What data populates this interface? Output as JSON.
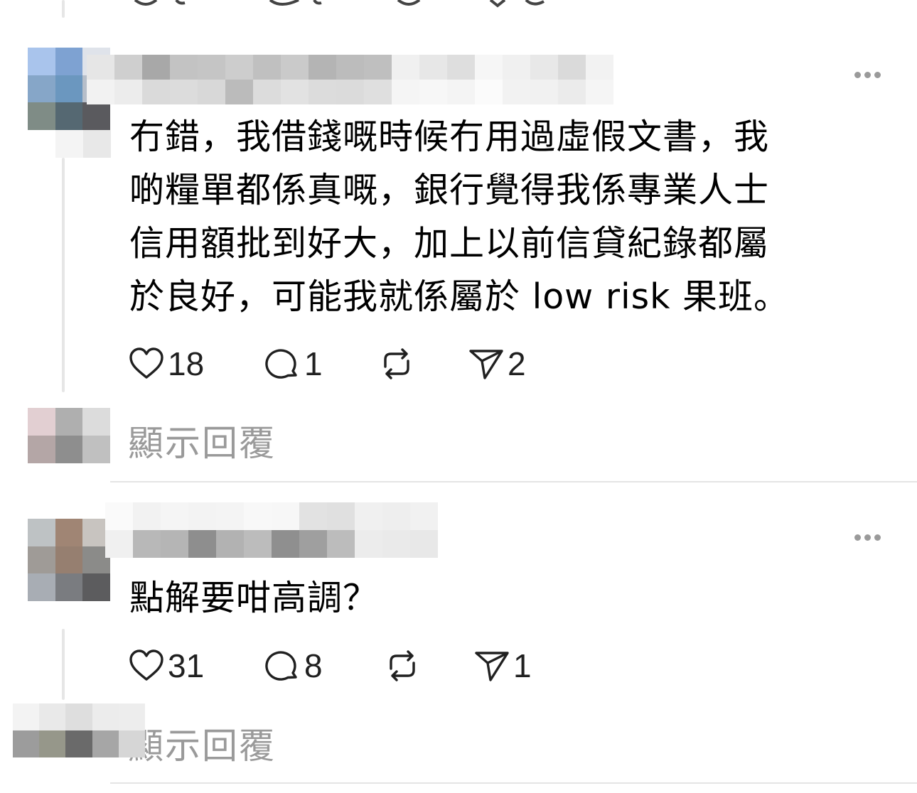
{
  "comments": [
    {
      "text": "冇錯，我借錢嘅時候冇用過虛假文書，我\n啲糧單都係真嘅，銀行覺得我係專業人士\n信用額批到好大，加上以前信貸紀錄都屬\n於良好，可能我就係屬於 low risk 果班。",
      "likes": "18",
      "replies": "1",
      "reposts": "",
      "shares": "2",
      "show_replies_label": "顯示回覆"
    },
    {
      "text": "點解要咁高調？",
      "likes": "31",
      "replies": "8",
      "reposts": "",
      "shares": "1",
      "show_replies_label": "顯示回覆"
    }
  ],
  "icons": {
    "like": "heart-icon",
    "reply": "speech-bubble-icon",
    "repost": "repost-arrows-icon",
    "share": "paper-plane-icon",
    "more": "more-dots-icon"
  },
  "colors": {
    "text": "#000000",
    "muted": "#9a9a9a",
    "icon": "#202020",
    "divider": "#e4e4e4"
  }
}
